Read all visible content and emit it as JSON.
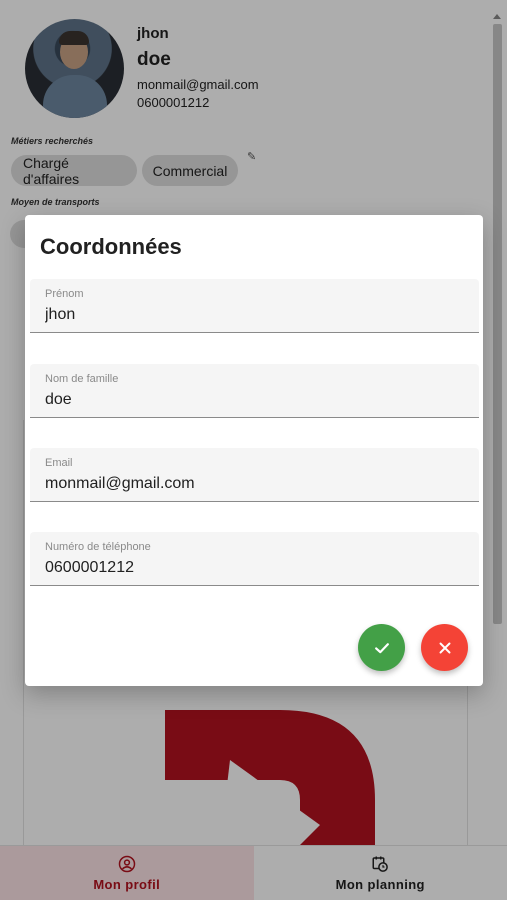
{
  "profile": {
    "first_name": "jhon",
    "last_name": "doe",
    "email": "monmail@gmail.com",
    "phone": "0600001212",
    "jobs_label": "Métiers recherchés",
    "jobs": [
      "Chargé d'affaires",
      "Commercial"
    ],
    "transport_label": "Moyen de transports"
  },
  "dialog": {
    "title": "Coordonnées",
    "fields": [
      {
        "label": "Prénom",
        "value": "jhon"
      },
      {
        "label": "Nom de famille",
        "value": "doe"
      },
      {
        "label": "Email",
        "value": "monmail@gmail.com"
      },
      {
        "label": "Numéro de téléphone",
        "value": "0600001212"
      }
    ],
    "confirm_icon": "check-icon",
    "cancel_icon": "close-icon"
  },
  "nav": {
    "items": [
      {
        "label": "Mon profil",
        "icon": "account-circle-icon",
        "active": true
      },
      {
        "label": "Mon planning",
        "icon": "calendar-clock-icon",
        "active": false
      }
    ]
  },
  "colors": {
    "brand_red": "#b3121f",
    "confirm_green": "#43a047",
    "cancel_red": "#f44336"
  }
}
